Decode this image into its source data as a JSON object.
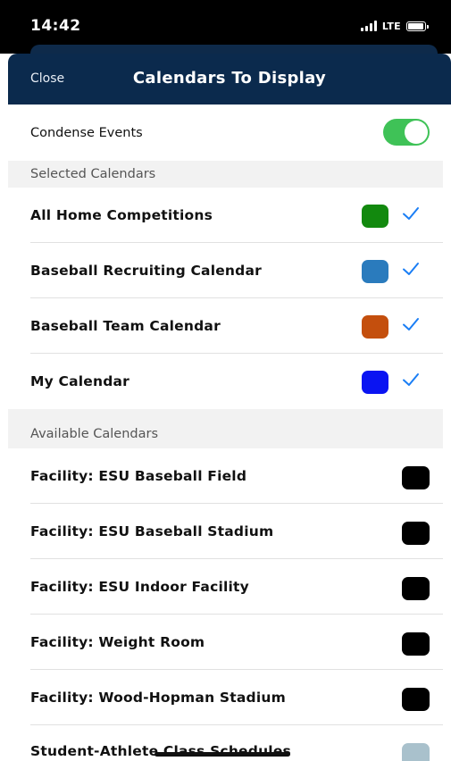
{
  "status": {
    "time": "14:42",
    "carrier": "LTE"
  },
  "nav": {
    "close_label": "Close",
    "title": "Calendars To Display"
  },
  "condense": {
    "label": "Condense Events",
    "enabled": true,
    "toggle_color": "#3fc257"
  },
  "selected": {
    "header": "Selected Calendars",
    "items": [
      {
        "label": "All Home Competitions",
        "color": "#12890e",
        "checked": true
      },
      {
        "label": "Baseball Recruiting Calendar",
        "color": "#2a7bbd",
        "checked": true
      },
      {
        "label": "Baseball Team Calendar",
        "color": "#c44f0d",
        "checked": true
      },
      {
        "label": "My Calendar",
        "color": "#0a14f2",
        "checked": true
      }
    ]
  },
  "available": {
    "header": "Available Calendars",
    "items": [
      {
        "label": "Facility: ESU Baseball Field",
        "color": "#000000"
      },
      {
        "label": "Facility: ESU Baseball Stadium",
        "color": "#000000"
      },
      {
        "label": "Facility: ESU Indoor Facility",
        "color": "#000000"
      },
      {
        "label": "Facility: Weight Room",
        "color": "#000000"
      },
      {
        "label": "Facility: Wood-Hopman Stadium",
        "color": "#000000"
      },
      {
        "label": "Student-Athlete Class Schedules",
        "color": "#a9c1cc"
      }
    ]
  },
  "colors": {
    "accent": "#1a7ef5",
    "nav_bg": "#0b2a4d"
  }
}
